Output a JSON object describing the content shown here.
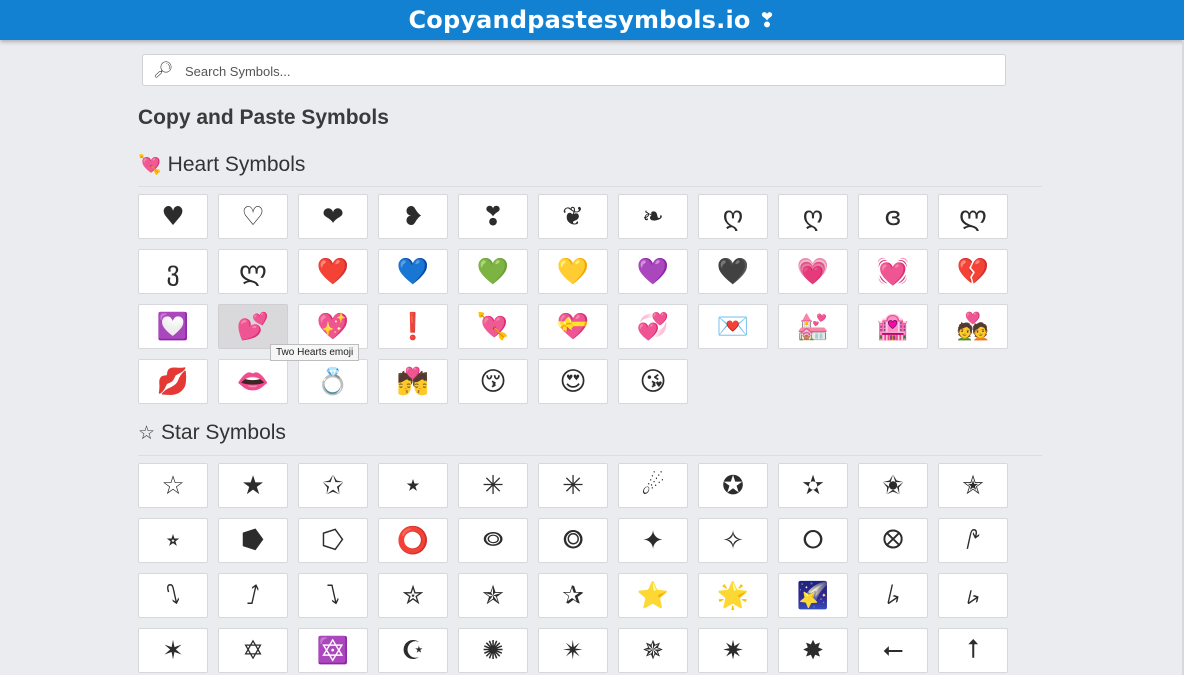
{
  "header": {
    "title": "Copyandpastesymbols.io",
    "heart": "❣"
  },
  "search": {
    "placeholder": "Search Symbols...",
    "value": "",
    "icon": "magnifier-icon"
  },
  "page_title": "Copy and Paste Symbols",
  "heart_section": {
    "icon": "💘",
    "title": "Heart Symbols",
    "symbols": [
      "♥",
      "♡",
      "❤",
      "❥",
      "❣",
      "❦",
      "❧",
      "ღ",
      "ღ",
      "ɞ",
      "ლ",
      "ვ",
      "ლ",
      "❤️",
      "💙",
      "💚",
      "💛",
      "💜",
      "🖤",
      "💗",
      "💓",
      "💔",
      "💟",
      "💕",
      "💖",
      "❗",
      "💘",
      "💝",
      "💞",
      "💌",
      "💒",
      "🏩",
      "💑",
      "💋",
      "👄",
      "💍",
      "💏",
      "😚",
      "😍",
      "😘"
    ],
    "hovered_index": 23,
    "tooltip": "Two Hearts emoji"
  },
  "star_section": {
    "icon": "☆",
    "title": "Star Symbols",
    "symbols": [
      "☆",
      "★",
      "✩",
      "⭑",
      "✳",
      "✳",
      "☄",
      "✪",
      "✫",
      "✬",
      "✭",
      "⭒",
      "⭓",
      "⭔",
      "⭕",
      "⭖",
      "⭗",
      "✦",
      "✧",
      "⭘",
      "⭙",
      "⭚",
      "⭛",
      "⭜",
      "⭝",
      "✮",
      "✯",
      "✰",
      "⭐",
      "🌟",
      "🌠",
      "⭞",
      "⭟",
      "✶",
      "✡",
      "🔯",
      "☪",
      "✺",
      "✴",
      "✵",
      "✷",
      "✸",
      "⭠",
      "⭡"
    ]
  }
}
